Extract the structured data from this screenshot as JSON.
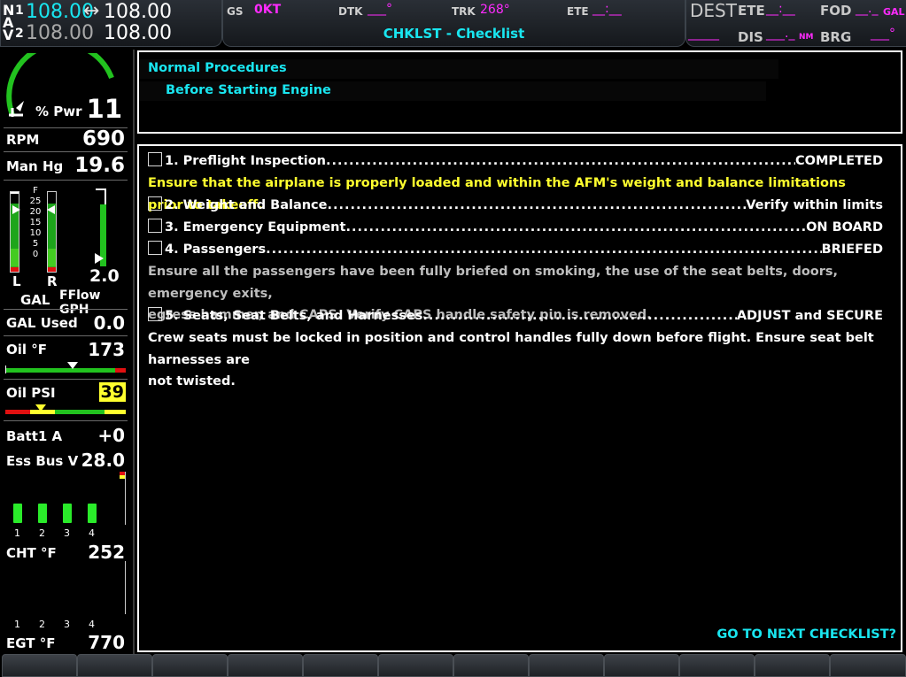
{
  "nav": {
    "n_label": "N",
    "a_label": "A",
    "v_label": "V",
    "nav1_index": "1",
    "nav2_index": "2",
    "nav1_active": "108.00",
    "nav1_standby": "108.00",
    "nav2_active": "108.00",
    "nav2_standby": "108.00",
    "swap_symbol": "↔"
  },
  "top": {
    "gs_label": "GS",
    "gs_value": "0KT",
    "dtk_label": "DTK",
    "dtk_value": "___°",
    "trk_label": "TRK",
    "trk_value": "268°",
    "ete_label": "ETE",
    "ete_value": "__:__",
    "page_title": "CHKLST - Checklist"
  },
  "dest": {
    "dest_label": "DEST",
    "dest_value": "_____",
    "ete_label": "ETE",
    "ete_value": "__:__",
    "fod_label": "FOD",
    "fod_value": "__._",
    "fod_unit": "GAL",
    "dis_label": "DIS",
    "dis_value": "___._",
    "dis_unit": "NM",
    "brg_label": "BRG",
    "brg_value": "___°"
  },
  "engine": {
    "pwr_label": "% Pwr",
    "pwr_value": "11",
    "rpm_label": "RPM",
    "rpm_value": "690",
    "manhg_label": "Man Hg",
    "manhg_value": "19.6",
    "fuel_ticks": [
      "F",
      "25",
      "20",
      "15",
      "10",
      "5",
      "0"
    ],
    "fuel_left_label": "L",
    "fuel_right_label": "R",
    "fuel_unit": "GAL",
    "fflow_value": "2.0",
    "fflow_label": "FFlow GPH",
    "gal_used_label": "GAL Used",
    "gal_used_value": "0.0",
    "oil_temp_label": "Oil °F",
    "oil_temp_value": "173",
    "oil_psi_label": "Oil PSI",
    "oil_psi_value": "39",
    "batt_label": "Batt1 A",
    "batt_value": "+0",
    "essbus_label": "Ess Bus V",
    "essbus_value": "28.0",
    "cyl_numbers": [
      "1",
      "2",
      "3",
      "4"
    ],
    "cht_label": "CHT °F",
    "cht_value": "252",
    "egt_label": "EGT °F",
    "egt_value": "770"
  },
  "checklist": {
    "group": "Normal Procedures",
    "name": "Before Starting Engine",
    "items": [
      {
        "label": "1. Preflight Inspection",
        "result": "COMPLETED"
      },
      {
        "label": "2. Weight and Balance",
        "result": "Verify within limits"
      },
      {
        "label": "3. Emergency Equipment",
        "result": "ON BOARD"
      },
      {
        "label": "4. Passengers",
        "result": "BRIEFED"
      },
      {
        "label": "5. Seats, Seat Belts, and Harnesses",
        "result": "ADJUST and SECURE"
      }
    ],
    "note1": "Ensure that the airplane is properly loaded and within the AFM's weight and balance limitations prior to takeoff.",
    "note2_line1": "Ensure all the passengers have been fully briefed on smoking, the use of the seat belts, doors, emergency exits,",
    "note2_line2": "egress hammer, and CAPS. Verify CAPS handle safety pin is removed.",
    "note3_line1": "Crew seats must be locked in position and control handles fully down before flight. Ensure seat belt harnesses are",
    "note3_line2": "not twisted.",
    "dots": "..........................................................................................................................................................................................................",
    "next_prompt": "GO TO NEXT CHECKLIST?"
  },
  "colors": {
    "cyan": "#19e6f0",
    "magenta": "#ff2bff",
    "yellow": "#ffff2e",
    "green": "#22c21f",
    "red": "#e01010"
  }
}
